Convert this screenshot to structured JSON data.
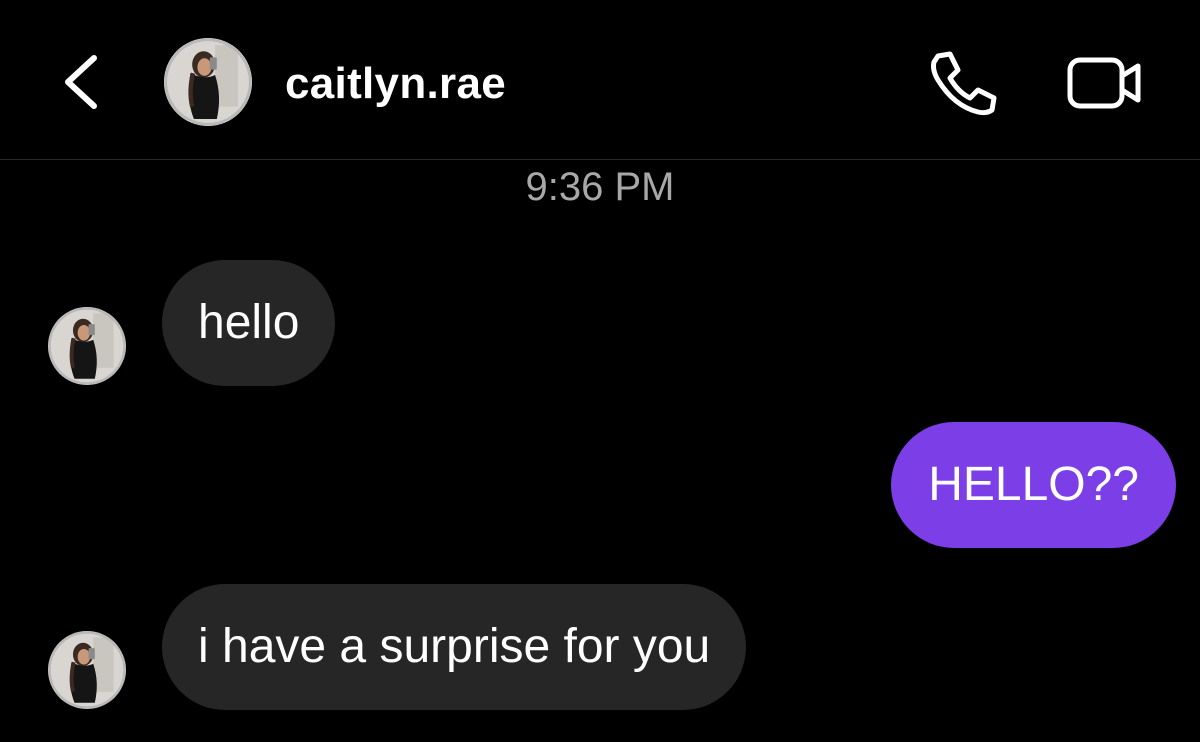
{
  "header": {
    "back_icon": "chevron-left-icon",
    "username": "caitlyn.rae",
    "call_icon": "phone-icon",
    "video_icon": "video-camera-icon"
  },
  "conversation": {
    "timestamp": "9:36 PM",
    "messages": [
      {
        "direction": "incoming",
        "text": "hello"
      },
      {
        "direction": "outgoing",
        "text": "HELLO??"
      },
      {
        "direction": "incoming",
        "text": "i have a surprise for you"
      }
    ]
  },
  "colors": {
    "background": "#000000",
    "incoming_bubble": "#262626",
    "outgoing_bubble": "#7c3ee6",
    "timestamp_text": "#a8a8a8"
  }
}
